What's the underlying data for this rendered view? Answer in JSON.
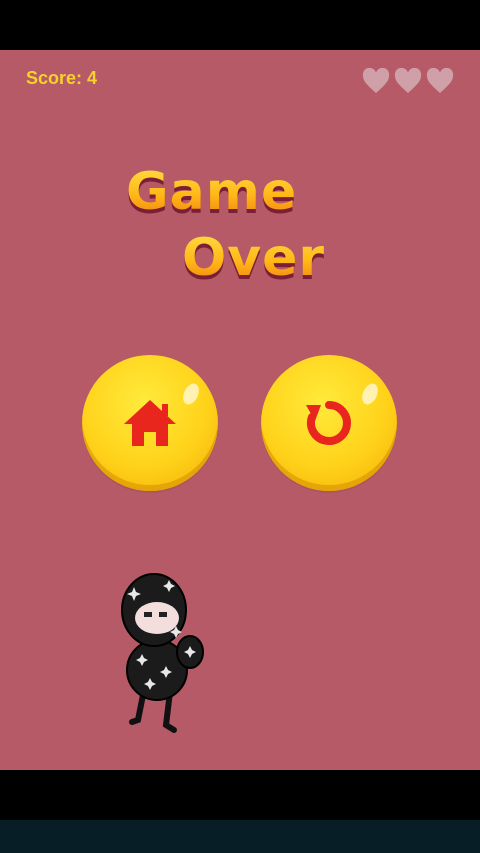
{
  "hud": {
    "score_label": "Score: 4",
    "lives_remaining": 0,
    "lives_total": 3
  },
  "title": {
    "line1": "Game",
    "line2": "Over"
  },
  "buttons": [
    {
      "name": "home",
      "icon": "home-icon"
    },
    {
      "name": "restart",
      "icon": "restart-icon"
    }
  ],
  "colors": {
    "background": "#b55a66",
    "button_yellow": "#ffd21a",
    "icon_red": "#e8261d",
    "score_text": "#f6d22a",
    "heart_empty": "#cfa0a8"
  }
}
